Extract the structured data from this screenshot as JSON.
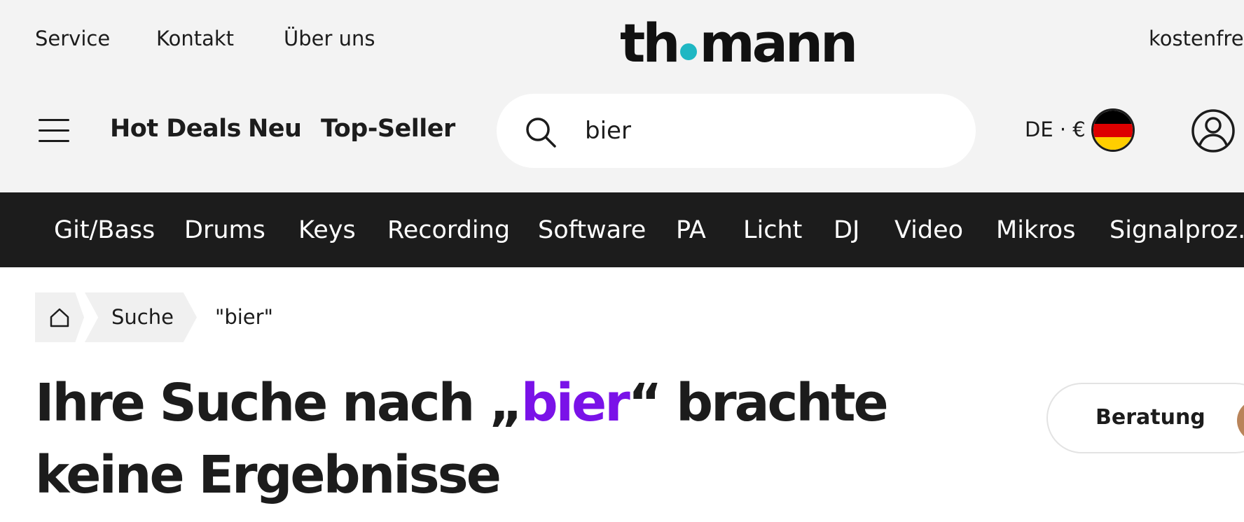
{
  "top_links": [
    "Service",
    "Kontakt",
    "Über uns"
  ],
  "logo": {
    "text_before": "th",
    "text_after": "mann",
    "dot_color": "#1fb7c3"
  },
  "shipping_text": "kostenfre",
  "quick_links": [
    "Hot Deals",
    "Neu",
    "Top-Seller"
  ],
  "search": {
    "value": "bier",
    "placeholder": ""
  },
  "locale": {
    "label": "DE · €"
  },
  "categories": [
    "Git/Bass",
    "Drums",
    "Keys",
    "Recording",
    "Software",
    "PA",
    "Licht",
    "DJ",
    "Video",
    "Mikros",
    "Signalproz."
  ],
  "breadcrumb": {
    "search": "Suche",
    "current": "\"bier\""
  },
  "headline": {
    "prefix": "Ihre Suche nach „",
    "query": "bier",
    "suffix": "“ brachte keine Ergebnisse"
  },
  "beratung": {
    "label": "Beratung"
  },
  "icons": {
    "menu": "hamburger-icon",
    "search": "search-icon",
    "flag": "germany-flag-icon",
    "account": "account-icon",
    "home": "home-icon"
  },
  "colors": {
    "header_bg": "#f3f3f3",
    "category_bar_bg": "#1c1c1c",
    "query_highlight": "#7a12e8",
    "logo_dot": "#1fb7c3"
  }
}
